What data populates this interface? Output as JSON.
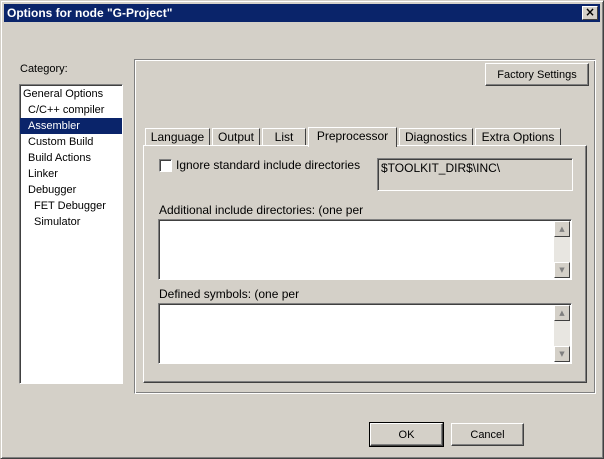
{
  "window": {
    "title": "Options for node \"G-Project\"",
    "close_glyph": "×"
  },
  "category": {
    "label": "Category:",
    "items": [
      {
        "label": "General Options",
        "level": 0,
        "selected": false
      },
      {
        "label": "C/C++ compiler",
        "level": 1,
        "selected": false
      },
      {
        "label": "Assembler",
        "level": 1,
        "selected": true
      },
      {
        "label": "Custom Build",
        "level": 1,
        "selected": false
      },
      {
        "label": "Build Actions",
        "level": 1,
        "selected": false
      },
      {
        "label": "Linker",
        "level": 1,
        "selected": false
      },
      {
        "label": "Debugger",
        "level": 1,
        "selected": false
      },
      {
        "label": "FET Debugger",
        "level": 2,
        "selected": false
      },
      {
        "label": "Simulator",
        "level": 2,
        "selected": false
      }
    ]
  },
  "factory_settings_label": "Factory Settings",
  "tabs": [
    {
      "label": "Language",
      "active": false
    },
    {
      "label": "Output",
      "active": false
    },
    {
      "label": "List",
      "active": false
    },
    {
      "label": "Preprocessor",
      "active": true
    },
    {
      "label": "Diagnostics",
      "active": false
    },
    {
      "label": "Extra Options",
      "active": false
    }
  ],
  "preprocessor": {
    "ignore_include": {
      "label": "Ignore standard include directories",
      "checked": false
    },
    "toolkit_path": "$TOOLKIT_DIR$\\INC\\",
    "additional_include_label": "Additional include directories: (one per",
    "additional_include_value": "",
    "defined_symbols_label": "Defined symbols: (one per",
    "defined_symbols_value": ""
  },
  "footer": {
    "ok_label": "OK",
    "cancel_label": "Cancel"
  }
}
